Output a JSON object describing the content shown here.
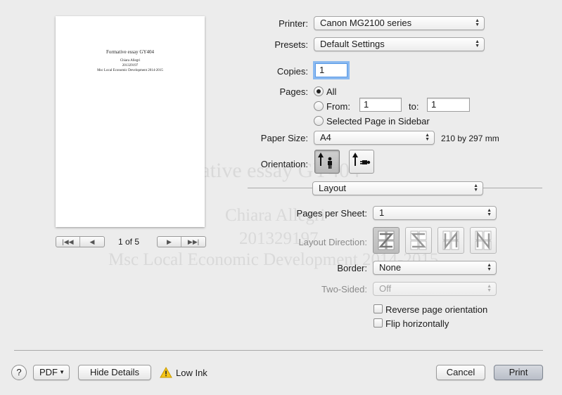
{
  "ghost_text": {
    "line1": "mative essay GY404",
    "line2": "Chiara Allegri",
    "line3": "201329197",
    "line4": "Msc Local Economic Development 2014-2015"
  },
  "preview": {
    "title": "Formative essay GY404",
    "author": "Chiara Allegri",
    "id": "201329197",
    "course": "Msc Local Economic Development 2014-2015",
    "page_indicator": "1 of 5"
  },
  "printer": {
    "label": "Printer:",
    "value": "Canon MG2100 series"
  },
  "presets": {
    "label": "Presets:",
    "value": "Default Settings"
  },
  "copies": {
    "label": "Copies:",
    "value": "1"
  },
  "pages": {
    "label": "Pages:",
    "all_label": "All",
    "from_label": "From:",
    "from_value": "1",
    "to_label": "to:",
    "to_value": "1",
    "selected_label": "Selected Page in Sidebar"
  },
  "paper_size": {
    "label": "Paper Size:",
    "value": "A4",
    "dimensions": "210 by 297 mm"
  },
  "orientation": {
    "label": "Orientation:"
  },
  "section": {
    "value": "Layout"
  },
  "pages_per_sheet": {
    "label": "Pages per Sheet:",
    "value": "1"
  },
  "layout_direction": {
    "label": "Layout Direction:"
  },
  "border": {
    "label": "Border:",
    "value": "None"
  },
  "two_sided": {
    "label": "Two-Sided:",
    "value": "Off"
  },
  "reverse": {
    "label": "Reverse page orientation"
  },
  "flip": {
    "label": "Flip horizontally"
  },
  "footer": {
    "help": "?",
    "pdf": "PDF",
    "hide_details": "Hide Details",
    "low_ink": "Low Ink",
    "cancel": "Cancel",
    "print": "Print"
  },
  "colors": {
    "accent_focus": "#8ab9f0",
    "warning": "#f5c518"
  }
}
